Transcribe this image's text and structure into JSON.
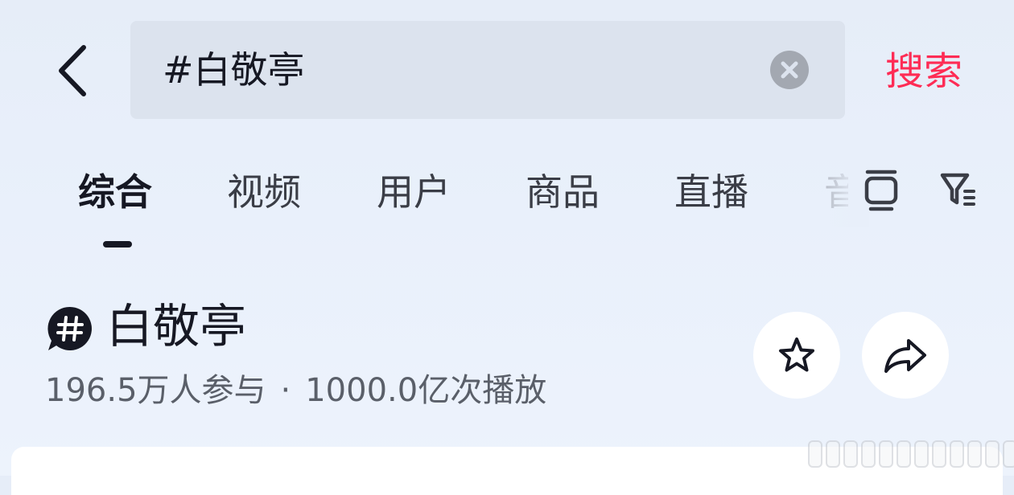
{
  "header": {
    "back_icon": "chevron-left-icon",
    "search_value": "#白敬亭",
    "clear_icon": "clear-circle-icon",
    "search_button_label": "搜索",
    "accent_color": "#fe2c55"
  },
  "tabs": [
    {
      "label": "综合",
      "active": true
    },
    {
      "label": "视频",
      "active": false
    },
    {
      "label": "用户",
      "active": false
    },
    {
      "label": "商品",
      "active": false
    },
    {
      "label": "直播",
      "active": false
    },
    {
      "label": "音",
      "active": false
    }
  ],
  "toolbar_icons": [
    "tv-icon",
    "filter-icon"
  ],
  "topic": {
    "badge_icon": "hashtag-bubble-icon",
    "title": "白敬亭",
    "participants": "196.5万人参与",
    "separator": "·",
    "plays": "1000.0亿次播放",
    "actions": [
      "star-icon",
      "share-icon"
    ]
  }
}
